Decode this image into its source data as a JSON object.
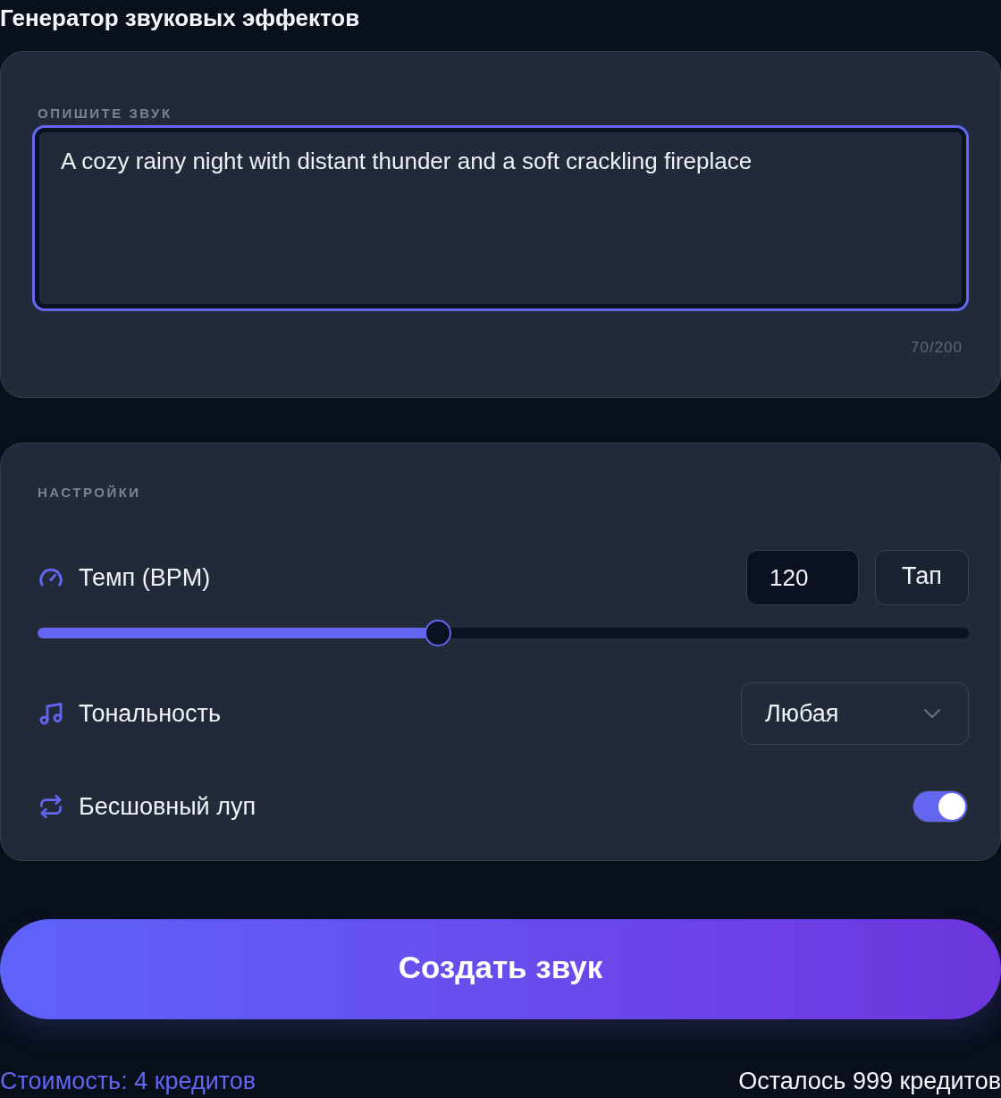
{
  "title": "Генератор звуковых эффектов",
  "prompt": {
    "label": "ОПИШИТЕ ЗВУК",
    "value": "A cozy rainy night with distant thunder and a soft crackling fireplace",
    "focused": true,
    "counter": "70/200"
  },
  "settings": {
    "heading": "НАСТРОЙКИ",
    "rows": [
      {
        "kind": "tempo",
        "label": "Темп (BPM)",
        "value": "120",
        "button": "Тап",
        "level": 0.43
      },
      {
        "kind": "select",
        "label": "Тональность",
        "value": "Любая"
      },
      {
        "kind": "toggle",
        "label": "Бесшовный луп",
        "on": true
      }
    ]
  },
  "generate_button": {
    "label": "Создать звук"
  },
  "footer": {
    "cost": "Стоимость: 4 кредитов",
    "remaining": "Осталось 999 кредитов"
  }
}
